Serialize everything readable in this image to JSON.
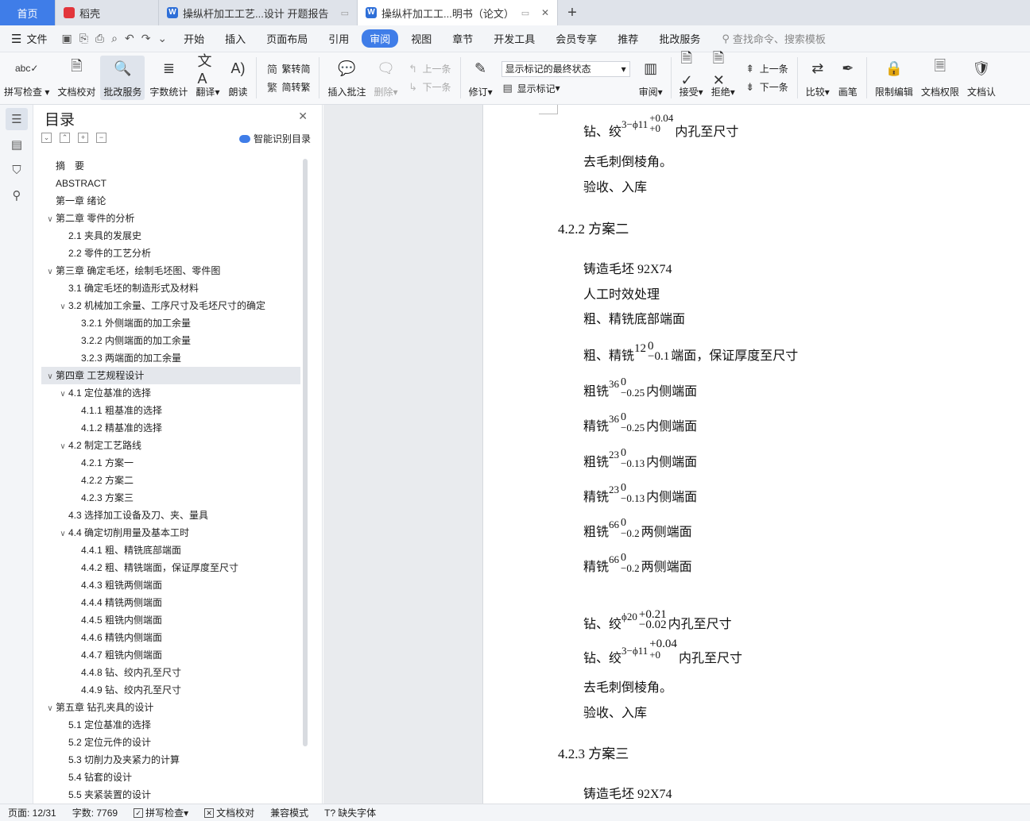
{
  "tabs": {
    "home": "首页",
    "draft": "稻壳",
    "doc1": "操纵杆加工工艺...设计 开题报告",
    "doc2": "操纵杆加工工...明书（论文）",
    "add": "+"
  },
  "menu": {
    "file": "文件",
    "items": [
      "开始",
      "插入",
      "页面布局",
      "引用",
      "审阅",
      "视图",
      "章节",
      "开发工具",
      "会员专享",
      "推荐",
      "批改服务"
    ],
    "active": "审阅",
    "search_placeholder": "查找命令、搜索模板"
  },
  "ribbon": {
    "spell_check": "拼写检查",
    "doc_proof": "文档校对",
    "correction_service": "批改服务",
    "word_count": "字数统计",
    "translate": "翻译",
    "read_aloud": "朗读",
    "trad_to_simp": "繁转简",
    "simp_to_trad": "简转繁",
    "insert_comment": "插入批注",
    "delete": "删除",
    "prev": "上一条",
    "next": "下一条",
    "revise": "修订",
    "markup_state": "显示标记的最终状态",
    "show_markup": "显示标记",
    "review": "审阅",
    "accept": "接受",
    "reject": "拒绝",
    "prev2": "上一条",
    "next2": "下一条",
    "compare": "比较",
    "pen": "画笔",
    "restrict_edit": "限制编辑",
    "doc_permission": "文档权限",
    "doc_auth": "文档认"
  },
  "toc": {
    "title": "目录",
    "smart": "智能识别目录",
    "items": [
      {
        "text": "摘　要",
        "level": 1,
        "chev": ""
      },
      {
        "text": "ABSTRACT",
        "level": 1,
        "chev": ""
      },
      {
        "text": "第一章  绪论",
        "level": 1,
        "chev": ""
      },
      {
        "text": "第二章  零件的分析",
        "level": 1,
        "chev": "v"
      },
      {
        "text": "2.1  夹具的发展史",
        "level": 2,
        "chev": ""
      },
      {
        "text": "2.2  零件的工艺分析",
        "level": 2,
        "chev": ""
      },
      {
        "text": "第三章  确定毛坯，绘制毛坯图、零件图",
        "level": 1,
        "chev": "v"
      },
      {
        "text": "3.1  确定毛坯的制造形式及材料",
        "level": 2,
        "chev": ""
      },
      {
        "text": "3.2  机械加工余量、工序尺寸及毛坯尺寸的确定",
        "level": 2,
        "chev": "v"
      },
      {
        "text": "3.2.1  外侧端面的加工余量",
        "level": 3,
        "chev": ""
      },
      {
        "text": "3.2.2  内侧端面的加工余量",
        "level": 3,
        "chev": ""
      },
      {
        "text": "3.2.3  两端面的加工余量",
        "level": 3,
        "chev": ""
      },
      {
        "text": "第四章  工艺规程设计",
        "level": 1,
        "chev": "v",
        "selected": true
      },
      {
        "text": "4.1  定位基准的选择",
        "level": 2,
        "chev": "v"
      },
      {
        "text": "4.1.1  粗基准的选择",
        "level": 3,
        "chev": ""
      },
      {
        "text": "4.1.2  精基准的选择",
        "level": 3,
        "chev": ""
      },
      {
        "text": "4.2  制定工艺路线",
        "level": 2,
        "chev": "v"
      },
      {
        "text": "4.2.1  方案一",
        "level": 3,
        "chev": ""
      },
      {
        "text": "4.2.2  方案二",
        "level": 3,
        "chev": ""
      },
      {
        "text": "4.2.3  方案三",
        "level": 3,
        "chev": ""
      },
      {
        "text": "4.3  选择加工设备及刀、夹、量具",
        "level": 2,
        "chev": ""
      },
      {
        "text": "4.4  确定切削用量及基本工时",
        "level": 2,
        "chev": "v"
      },
      {
        "text": "4.4.1  粗、精铣底部端面",
        "level": 3,
        "chev": ""
      },
      {
        "text": "4.4.2  粗、精铣端面，保证厚度至尺寸",
        "level": 3,
        "chev": ""
      },
      {
        "text": "4.4.3  粗铣两侧端面",
        "level": 3,
        "chev": ""
      },
      {
        "text": "4.4.4  精铣两侧端面",
        "level": 3,
        "chev": ""
      },
      {
        "text": "4.4.5  粗铣内侧端面",
        "level": 3,
        "chev": ""
      },
      {
        "text": "4.4.6  精铣内侧端面",
        "level": 3,
        "chev": ""
      },
      {
        "text": "4.4.7  粗铣内侧端面",
        "level": 3,
        "chev": ""
      },
      {
        "text": "4.4.8  钻、绞内孔至尺寸",
        "level": 3,
        "chev": ""
      },
      {
        "text": "4.4.9  钻、绞内孔至尺寸",
        "level": 3,
        "chev": ""
      },
      {
        "text": "第五章  钻孔夹具的设计",
        "level": 1,
        "chev": "v"
      },
      {
        "text": "5.1 定位基准的选择",
        "level": 2,
        "chev": ""
      },
      {
        "text": "5.2 定位元件的设计",
        "level": 2,
        "chev": ""
      },
      {
        "text": "5.3 切削力及夹紧力的计算",
        "level": 2,
        "chev": ""
      },
      {
        "text": "5.4 钻套的设计",
        "level": 2,
        "chev": ""
      },
      {
        "text": "5.5 夹紧装置的设计",
        "level": 2,
        "chev": ""
      }
    ]
  },
  "document": {
    "l1_pre": "钻、绞",
    "l1_math": "3−ϕ11",
    "l1_up": "+0.04",
    "l1_low": "+0",
    "l1_post": "内孔至尺寸",
    "l2": "去毛刺倒棱角。",
    "l3": "验收、入库",
    "h1": "4.2.2  方案二",
    "l4": "铸造毛坯 92X74",
    "l5": "人工时效处理",
    "l6": "粗、精铣底部端面",
    "l7_pre": "粗、精铣",
    "l7_num": "12",
    "l7_up": "0",
    "l7_low": "−0.1",
    "l7_post": "端面，保证厚度至尺寸",
    "rows": [
      {
        "pre": "粗铣",
        "num": "36",
        "up": "0",
        "low": "−0.25",
        "post": "内侧端面"
      },
      {
        "pre": "精铣",
        "num": "36",
        "up": "0",
        "low": "−0.25",
        "post": "内侧端面"
      },
      {
        "pre": "粗铣",
        "num": "23",
        "up": "0",
        "low": "−0.13",
        "post": "内侧端面"
      },
      {
        "pre": "精铣",
        "num": "23",
        "up": "0",
        "low": "−0.13",
        "post": "内侧端面"
      },
      {
        "pre": "粗铣",
        "num": "66",
        "up": "0",
        "low": "−0.2",
        "post": "两侧端面"
      },
      {
        "pre": "精铣",
        "num": "66",
        "up": "0",
        "low": "−0.2",
        "post": "两侧端面"
      }
    ],
    "l8_pre": "钻、绞",
    "l8_math": "ϕ20",
    "l8_up": "+0.21",
    "l8_low": "−0.02",
    "l8_post": "内孔至尺寸",
    "l9_pre": "钻、绞",
    "l9_math": "3−ϕ11",
    "l9_up": "+0.04",
    "l9_low": "+0",
    "l9_post": "内孔至尺寸",
    "l10": "去毛刺倒棱角。",
    "l11": "验收、入库",
    "h2": "4.2.3  方案三",
    "l12": "铸造毛坯 92X74"
  },
  "status": {
    "page": "页面: 12/31",
    "words": "字数: 7769",
    "spell": "拼写检查",
    "proof": "文档校对",
    "compat": "兼容模式",
    "missing_font": "缺失字体"
  }
}
